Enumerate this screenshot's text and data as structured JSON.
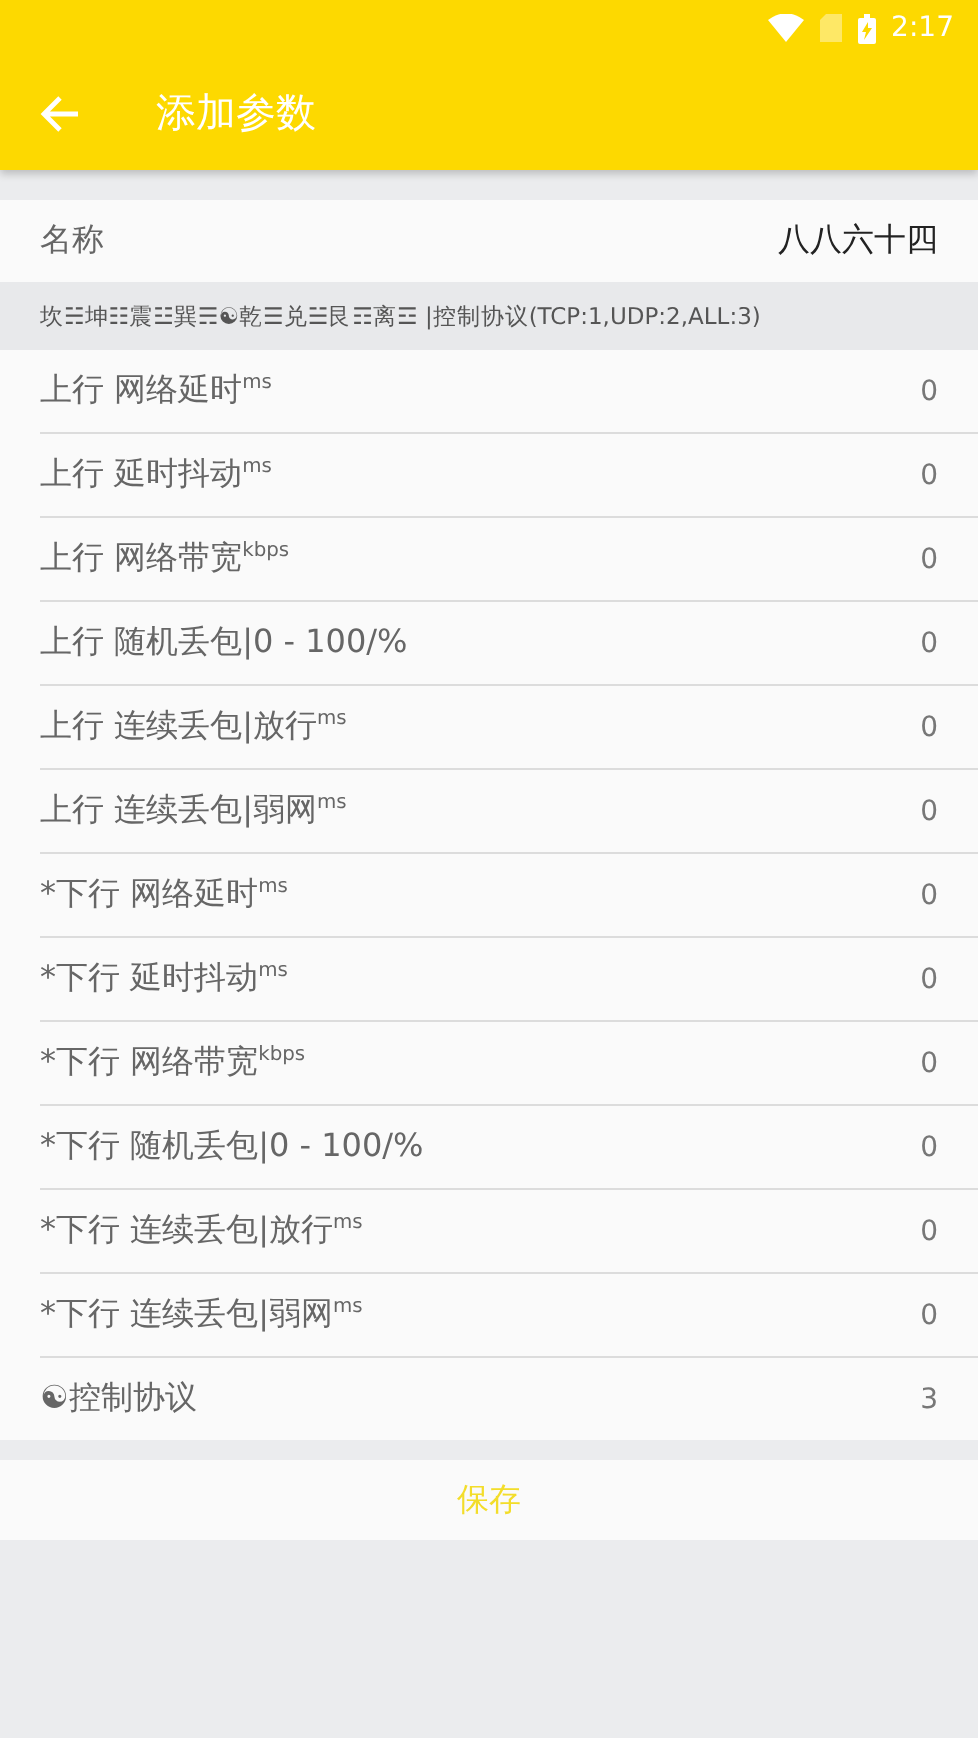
{
  "status_bar": {
    "time": "2:17"
  },
  "app_bar": {
    "title": "添加参数"
  },
  "name_row": {
    "label": "名称",
    "value": "八八六十四"
  },
  "section_header": "坎☵坤☷震☳巽☴☯乾☰兑☱艮☶离☲ |控制协议(TCP:1,UDP:2,ALL:3)",
  "params": [
    {
      "label": "上行 网络延时$^{ms}$",
      "value": "0"
    },
    {
      "label": "上行 延时抖动$^{ms}$",
      "value": "0"
    },
    {
      "label": "上行 网络带宽$^{kbps}$",
      "value": "0"
    },
    {
      "label": "上行 随机丢包|0 - 100/%",
      "value": "0"
    },
    {
      "label": "上行 连续丢包|放行$^{ms}$",
      "value": "0"
    },
    {
      "label": "上行 连续丢包|弱网$^{ms}$",
      "value": "0"
    },
    {
      "label": "*下行 网络延时$^{ms}$",
      "value": "0"
    },
    {
      "label": "*下行 延时抖动$^{ms}$",
      "value": "0"
    },
    {
      "label": "*下行 网络带宽$^{kbps}$",
      "value": "0"
    },
    {
      "label": "*下行 随机丢包|0 - 100/%",
      "value": "0"
    },
    {
      "label": "*下行 连续丢包|放行$^{ms}$",
      "value": "0"
    },
    {
      "label": "*下行 连续丢包|弱网$^{ms}$",
      "value": "0"
    },
    {
      "label": "☯控制协议",
      "value": "3"
    }
  ],
  "save_button": "保存"
}
